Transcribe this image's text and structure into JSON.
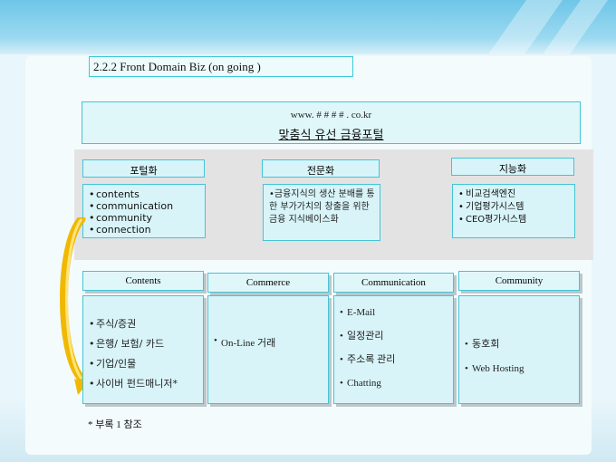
{
  "title": "2.2.2 Front Domain Biz (on going )",
  "portal": {
    "url": "www. # # # # . co.kr",
    "name": "맞춤식 유선 금융포털"
  },
  "pillars": [
    {
      "heading": "포털화",
      "items": [
        "contents",
        "communication",
        "community",
        "connection"
      ]
    },
    {
      "heading": "전문화",
      "text": "•금융지식의 생산 분배를 통한 부가가치의 창출을 위한 금융 지식베이스화"
    },
    {
      "heading": "지능화",
      "items": [
        "비교검색엔진",
        "기업평가시스템",
        "CEO평가시스템"
      ]
    }
  ],
  "columns": [
    {
      "heading": "Contents",
      "items": [
        "주식/증권",
        "은행/ 보험/ 카드",
        "기업/인물",
        "사이버 펀드매니저*"
      ]
    },
    {
      "heading": "Commerce",
      "items": [
        "On-Line 거래"
      ]
    },
    {
      "heading": "Communication",
      "items": [
        "E-Mail",
        "일정관리",
        "주소록 관리",
        "Chatting"
      ]
    },
    {
      "heading": "Community",
      "items": [
        "동호회",
        "Web Hosting"
      ]
    }
  ],
  "footnote": "* 부록 1 참조",
  "colors": {
    "box_fill": "#d8f4f8",
    "box_border": "#44c4d4",
    "arrow": "#f0b800"
  }
}
